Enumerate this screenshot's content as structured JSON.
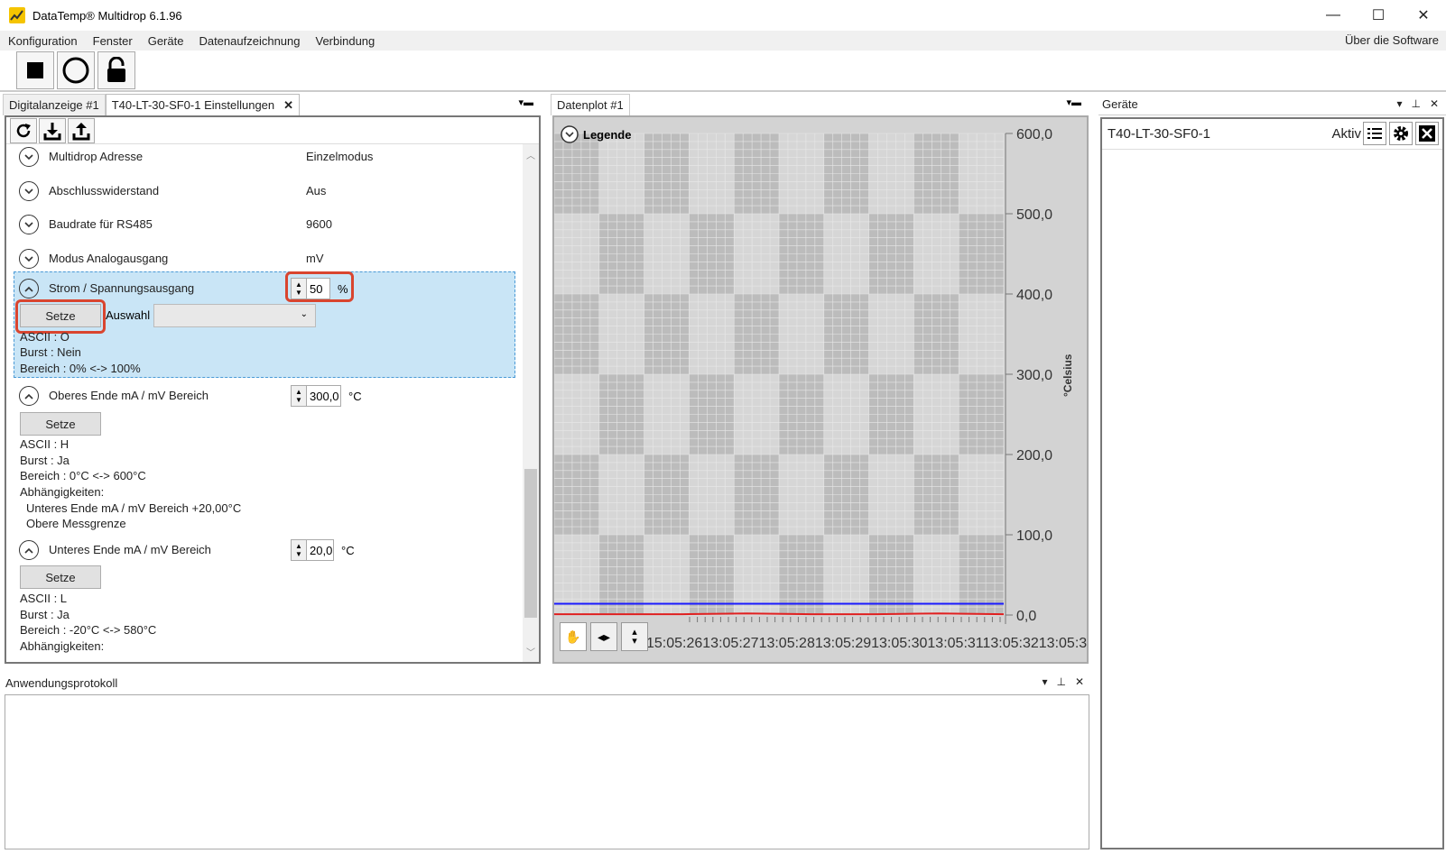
{
  "window": {
    "title": "DataTemp® Multidrop 6.1.96",
    "controls": [
      "—",
      "☐",
      "✕"
    ]
  },
  "menu": {
    "items": [
      "Konfiguration",
      "Fenster",
      "Geräte",
      "Datenaufzeichnung",
      "Verbindung"
    ],
    "right": "Über die Software"
  },
  "toolbar": {
    "buttons": [
      "stop-icon",
      "record-icon",
      "lock-icon"
    ]
  },
  "left": {
    "tabs": [
      {
        "label": "Digitalanzeige #1"
      },
      {
        "label": "T40-LT-30-SF0-1 Einstellungen"
      }
    ],
    "rows": [
      {
        "label": "Multidrop Adresse",
        "value": "Einzelmodus"
      },
      {
        "label": "Abschlusswiderstand",
        "value": "Aus"
      },
      {
        "label": "Baudrate für RS485",
        "value": "9600"
      },
      {
        "label": "Modus Analogausgang",
        "value": "mV"
      }
    ],
    "strom": {
      "label": "Strom / Spannungsausgang",
      "value": "50",
      "unit": "%",
      "button": "Setze",
      "auswahl": "Auswahl",
      "info": [
        "ASCII : O",
        "Burst : Nein",
        "Bereich : 0% <-> 100%"
      ]
    },
    "oberes": {
      "label": "Oberes Ende mA  / mV Bereich",
      "value": "300,0",
      "unit": "°C",
      "button": "Setze",
      "info": [
        "ASCII : H",
        "Burst : Ja",
        "Bereich : 0°C <-> 600°C",
        "Abhängigkeiten:",
        "Unteres Ende mA / mV Bereich +20,00°C",
        "Obere Messgrenze"
      ]
    },
    "unteres": {
      "label": "Unteres Ende mA / mV Bereich",
      "value": "20,0",
      "unit": "°C",
      "button": "Setze",
      "info": [
        "ASCII : L",
        "Burst : Ja",
        "Bereich : -20°C <-> 580°C",
        "Abhängigkeiten:"
      ]
    }
  },
  "plot": {
    "tab": "Datenplot #1",
    "legend": "Legende",
    "y_unit": "°Celsius",
    "x_tick_text": "15:05:2613:05:2713:05:2813:05:2913:05:3013:05:3113:05:3213:05:33",
    "y_ticks": [
      "600,0",
      "500,0",
      "400,0",
      "300,0",
      "200,0",
      "100,0",
      "0,0"
    ]
  },
  "chart_data": {
    "type": "line",
    "ylabel": "°Celsius",
    "ylim": [
      0,
      600
    ],
    "series": [
      {
        "color": "#1a1aff",
        "values": [
          14,
          14,
          14,
          14,
          14,
          14,
          14,
          14
        ]
      },
      {
        "color": "#e02020",
        "values": [
          1,
          1,
          1,
          2,
          1,
          1,
          2,
          1
        ]
      }
    ]
  },
  "right": {
    "title": "Geräte",
    "device": "T40-LT-30-SF0-1",
    "status": "Aktiv"
  },
  "bottom": {
    "title": "Anwendungsprotokoll"
  }
}
